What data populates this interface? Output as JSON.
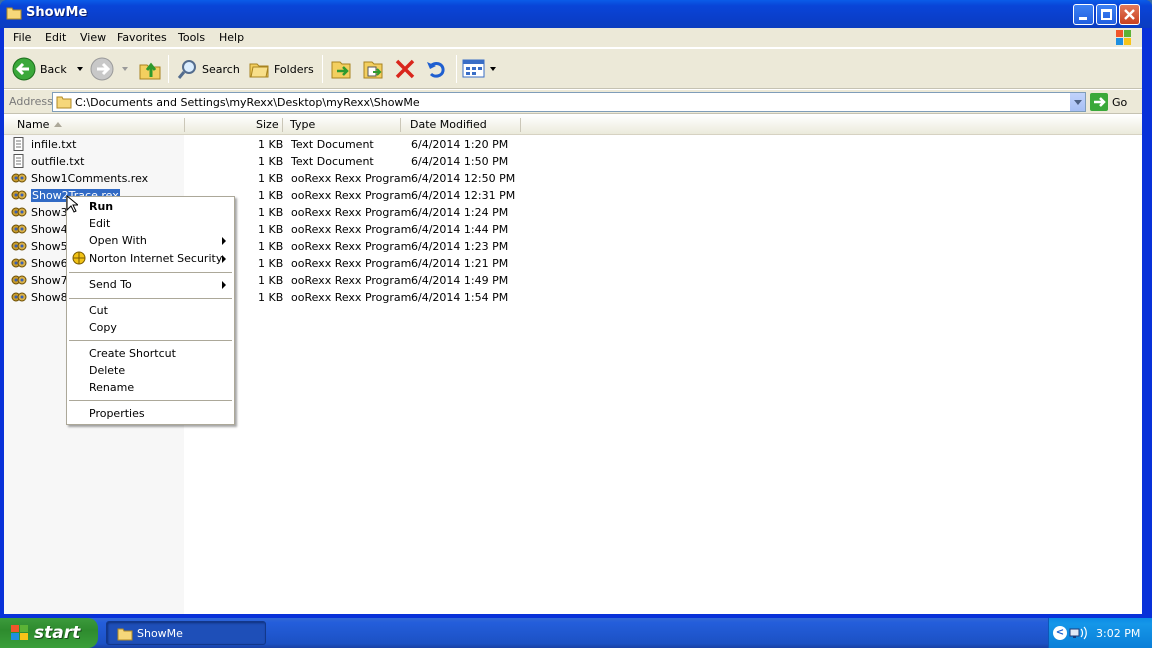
{
  "window": {
    "title": "ShowMe"
  },
  "menubar": [
    "File",
    "Edit",
    "View",
    "Favorites",
    "Tools",
    "Help"
  ],
  "toolbar": {
    "back": "Back",
    "search": "Search",
    "folders": "Folders"
  },
  "address": {
    "label": "Address",
    "path": "C:\\Documents and Settings\\myRexx\\Desktop\\myRexx\\ShowMe",
    "go": "Go"
  },
  "columns": {
    "name": "Name",
    "size": "Size",
    "type": "Type",
    "modified": "Date Modified"
  },
  "files": [
    {
      "name": "infile.txt",
      "size": "1 KB",
      "type": "Text Document",
      "modified": "6/4/2014 1:20 PM",
      "icon": "text-file-icon"
    },
    {
      "name": "outfile.txt",
      "size": "1 KB",
      "type": "Text Document",
      "modified": "6/4/2014 1:50 PM",
      "icon": "text-file-icon"
    },
    {
      "name": "Show1Comments.rex",
      "size": "1 KB",
      "type": "ooRexx Rexx Program",
      "modified": "6/4/2014 12:50 PM",
      "icon": "rexx-file-icon"
    },
    {
      "name": "Show2Trace.rex",
      "size": "1 KB",
      "type": "ooRexx Rexx Program",
      "modified": "6/4/2014 12:31 PM",
      "icon": "rexx-file-icon"
    },
    {
      "name": "Show3V",
      "size": "1 KB",
      "type": "ooRexx Rexx Program",
      "modified": "6/4/2014 1:24 PM",
      "icon": "rexx-file-icon"
    },
    {
      "name": "Show4s",
      "size": "1 KB",
      "type": "ooRexx Rexx Program",
      "modified": "6/4/2014 1:44 PM",
      "icon": "rexx-file-icon"
    },
    {
      "name": "Show5D",
      "size": "1 KB",
      "type": "ooRexx Rexx Program",
      "modified": "6/4/2014 1:23 PM",
      "icon": "rexx-file-icon"
    },
    {
      "name": "Show6Li",
      "size": "1 KB",
      "type": "ooRexx Rexx Program",
      "modified": "6/4/2014 1:21 PM",
      "icon": "rexx-file-icon"
    },
    {
      "name": "Show7Li",
      "size": "1 KB",
      "type": "ooRexx Rexx Program",
      "modified": "6/4/2014 1:49 PM",
      "icon": "rexx-file-icon"
    },
    {
      "name": "Show8N",
      "size": "1 KB",
      "type": "ooRexx Rexx Program",
      "modified": "6/4/2014 1:54 PM",
      "icon": "rexx-file-icon"
    }
  ],
  "context_menu": {
    "run": "Run",
    "edit": "Edit",
    "open_with": "Open With",
    "norton": "Norton Internet Security",
    "send_to": "Send To",
    "cut": "Cut",
    "copy": "Copy",
    "create_shortcut": "Create Shortcut",
    "delete": "Delete",
    "rename": "Rename",
    "properties": "Properties"
  },
  "taskbar": {
    "start": "start",
    "task": "ShowMe",
    "clock": "3:02 PM"
  },
  "colors": {
    "titlebar": "#0a3fcc",
    "selection": "#316ac5",
    "chrome": "#ece9d8"
  }
}
